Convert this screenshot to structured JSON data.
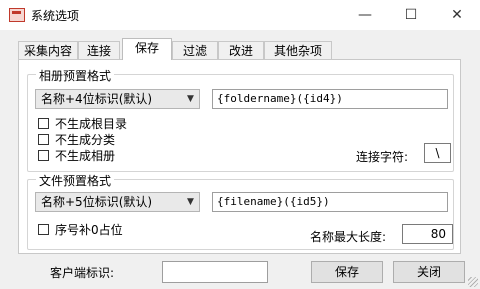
{
  "window": {
    "title": "系统选项",
    "controls": {
      "minimize": "—",
      "maximize": "☐",
      "close": "✕"
    }
  },
  "tabs": [
    {
      "label": "采集内容"
    },
    {
      "label": "连接"
    },
    {
      "label": "保存",
      "active": true
    },
    {
      "label": "过滤"
    },
    {
      "label": "改进"
    },
    {
      "label": "其他杂项"
    }
  ],
  "album_group": {
    "title": "相册预置格式",
    "format_select": "名称+4位标识(默认)",
    "format_value": "{foldername}({id4})",
    "checkboxes": [
      {
        "label": "不生成根目录",
        "checked": false
      },
      {
        "label": "不生成分类",
        "checked": false
      },
      {
        "label": "不生成相册",
        "checked": false
      }
    ],
    "separator_label": "连接字符:",
    "separator_value": "\\"
  },
  "file_group": {
    "title": "文件预置格式",
    "format_select": "名称+5位标识(默认)",
    "format_value": "{filename}({id5})",
    "checkbox": {
      "label": "序号补0占位",
      "checked": false
    },
    "maxlen_label": "名称最大长度:",
    "maxlen_value": "80"
  },
  "footer": {
    "client_label": "客户端标识:",
    "client_value": "",
    "save_button": "保存",
    "close_button": "关闭"
  }
}
